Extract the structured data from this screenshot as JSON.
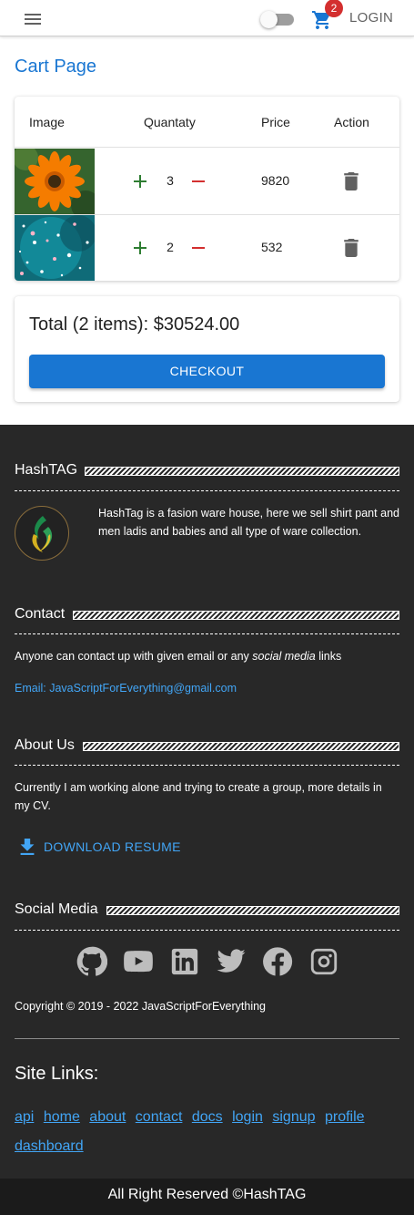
{
  "appbar": {
    "cart_count": "2",
    "login_label": "LOGIN"
  },
  "page": {
    "title": "Cart Page"
  },
  "cart_table": {
    "headers": [
      "Image",
      "Quantaty",
      "Price",
      "Action"
    ],
    "rows": [
      {
        "image": "orange-flower",
        "quantity": "3",
        "price": "9820"
      },
      {
        "image": "teal-bokeh",
        "quantity": "2",
        "price": "532"
      }
    ]
  },
  "summary": {
    "total_text": "Total (2 items): $30524.00",
    "checkout_label": "CHECKOUT"
  },
  "footer": {
    "hashtag": {
      "title": "HashTAG",
      "text": "HashTag is a fasion ware house, here we sell shirt pant and men ladis and babies and all type of ware collection."
    },
    "contact": {
      "title": "Contact",
      "text_before": "Anyone can contact up with given email or any ",
      "text_em": "social media",
      "text_after": " links",
      "email": "Email: JavaScriptForEverything@gmail.com"
    },
    "about": {
      "title": "About Us",
      "text": "Currently I am working alone and trying to create a group, more details in my CV.",
      "download_label": "DOWNLOAD RESUME"
    },
    "social": {
      "title": "Social Media",
      "icons": [
        "github-icon",
        "youtube-icon",
        "linkedin-icon",
        "twitter-icon",
        "facebook-icon",
        "instagram-icon"
      ]
    },
    "copyright": "Copyright © 2019 - 2022 JavaScriptForEverything",
    "site_links": {
      "title": "Site Links:",
      "links": [
        "api",
        "home",
        "about",
        "contact",
        "docs",
        "login",
        "signup",
        "profile",
        "dashboard"
      ]
    },
    "bottom_text": "All Right Reserved ©HashTAG"
  },
  "colors": {
    "primary": "#1976d2",
    "footer_bg": "#282828",
    "badge": "#d32f2f",
    "plus": "#2e7d32",
    "minus": "#d32f2f",
    "link": "#42a5f5"
  }
}
